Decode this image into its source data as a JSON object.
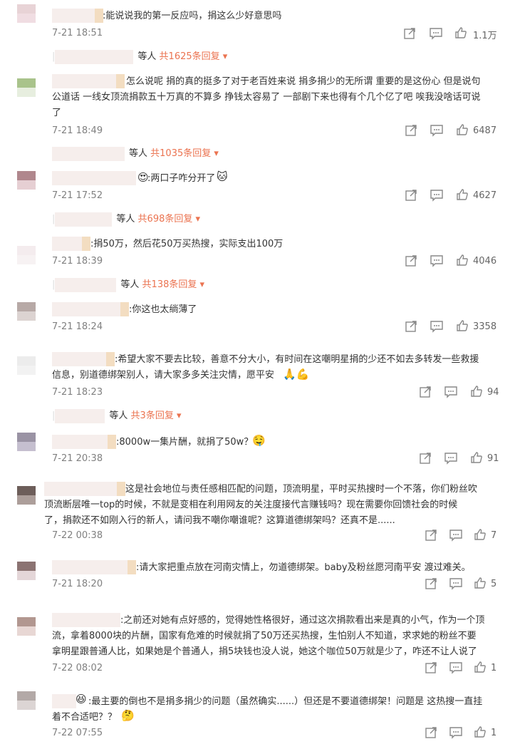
{
  "comments": [
    {
      "text": ":能说说我的第一反应吗，捐这么少好意思吗",
      "time": "7-21 18:51",
      "likes": "1.1万",
      "reply_prefix": "等人",
      "reply_more": "共1625条回复 ▾"
    },
    {
      "text_lines": [
        "怎么说呢 捐的真的挺多了对于老百姓来说 捐多捐少的无所谓 重要的是这份心 但是说句",
        "公道话 一线女顶流捐款五十万真的不算多 挣钱太容易了 一部剧下来也得有个几个亿了吧 唉我没啥话可说",
        "了"
      ],
      "time": "7-21 18:49",
      "likes": "6487",
      "reply_prefix": "等人",
      "reply_more": "共1035条回复 ▾"
    },
    {
      "text": ":两口子咋分开了",
      "time": "7-21 17:52",
      "likes": "4627",
      "reply_prefix": "等人",
      "reply_more": "共698条回复 ▾"
    },
    {
      "text": ":捐50万，然后花50万买热搜，实际支出100万",
      "time": "7-21 18:39",
      "likes": "4046",
      "reply_prefix": "等人",
      "reply_more": "共138条回复 ▾"
    },
    {
      "text": ":你这也太绱薄了",
      "time": "7-21 18:24",
      "likes": "3358"
    },
    {
      "text_lines": [
        ":希望大家不要去比较，善意不分大小，有时间在这嘲明星捐的少还不如去多转发一些救援",
        "信息，别道德绑架别人，请大家多多关注灾情，愿平安"
      ],
      "time": "7-21 18:23",
      "likes": "94",
      "reply_prefix": "等人",
      "reply_more": "共3条回复 ▾"
    },
    {
      "text": ":8000w一集片酬，就捐了50w？",
      "time": "7-21 20:38",
      "likes": "91"
    },
    {
      "text_lines": [
        "这是社会地位与责任感相匹配的问题，顶流明星，平时买热搜时一个不落，你们粉丝吹",
        "顶流断层唯一top的时候，不就是变相在利用网友的关注度接代言赚钱吗？现在需要你回馈社会的时候",
        "了，捐款还不如刚入行的新人，请问我不嘲你嘲谁呢？这算道德绑架吗？还真不是......"
      ],
      "time": "7-22 00:38",
      "likes": "7"
    },
    {
      "text": ":请大家把重点放在河南灾情上，勿道德绑架。baby及粉丝愿河南平安 渡过难关。",
      "time": "7-21 18:20",
      "likes": "5"
    },
    {
      "text_lines": [
        ":之前还对她有点好感的，觉得她性格很好，通过这次捐款看出来是真的小气，作为一个顶",
        "流，拿着8000块的片酬，国家有危难的时候就捐了50万还买热搜，生怕别人不知道，求求她的粉丝不要",
        "拿明星跟普通人比，如果她是个普通人，捐5块钱也没人说，她这个咖位50万就是少了，咋还不让人说了"
      ],
      "time": "7-22 08:02",
      "likes": "1"
    },
    {
      "text_lines": ":最主要的倒也不是捐多捐少的问题（虽然确实......）但还是不要道德绑架！问题是 这热搜一直挂",
      "time": "7-22 07:55",
      "likes": "1",
      "text_line2": "着不合适吧？？"
    }
  ]
}
